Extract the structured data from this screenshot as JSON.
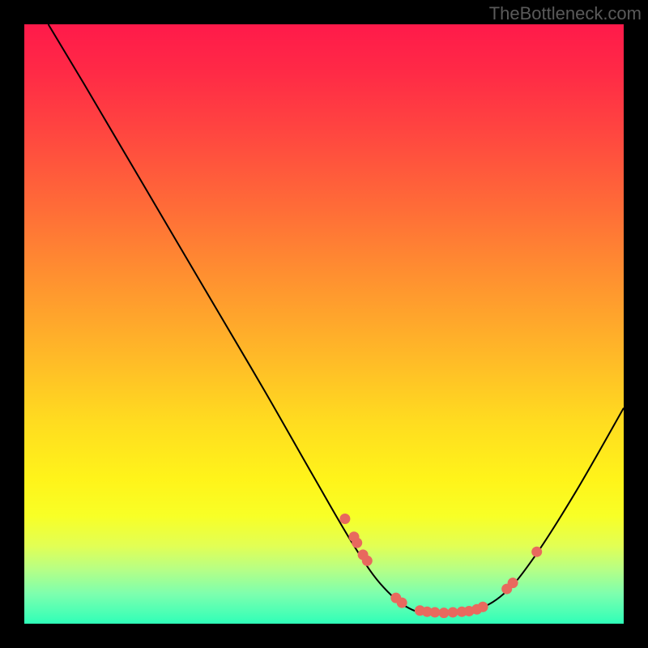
{
  "watermark": "TheBottleneck.com",
  "chart_data": {
    "type": "line",
    "title": "",
    "xlabel": "",
    "ylabel": "",
    "xlim": [
      0,
      100
    ],
    "ylim": [
      0,
      100
    ],
    "curve": [
      {
        "x": 4,
        "y": 100
      },
      {
        "x": 10,
        "y": 90
      },
      {
        "x": 20,
        "y": 73
      },
      {
        "x": 30,
        "y": 56
      },
      {
        "x": 40,
        "y": 39
      },
      {
        "x": 48,
        "y": 25
      },
      {
        "x": 55,
        "y": 13
      },
      {
        "x": 60,
        "y": 6
      },
      {
        "x": 65,
        "y": 2.2
      },
      {
        "x": 70,
        "y": 1.8
      },
      {
        "x": 75,
        "y": 2.2
      },
      {
        "x": 80,
        "y": 5
      },
      {
        "x": 85,
        "y": 11
      },
      {
        "x": 92,
        "y": 22
      },
      {
        "x": 100,
        "y": 36
      }
    ],
    "markers": [
      {
        "x": 53.5,
        "y": 17.5
      },
      {
        "x": 55,
        "y": 14.5
      },
      {
        "x": 55.5,
        "y": 13.5
      },
      {
        "x": 56.5,
        "y": 11.5
      },
      {
        "x": 57.2,
        "y": 10.5
      },
      {
        "x": 62,
        "y": 4.3
      },
      {
        "x": 63,
        "y": 3.5
      },
      {
        "x": 66,
        "y": 2.2
      },
      {
        "x": 67.2,
        "y": 2.0
      },
      {
        "x": 68.5,
        "y": 1.9
      },
      {
        "x": 70,
        "y": 1.8
      },
      {
        "x": 71.5,
        "y": 1.9
      },
      {
        "x": 73,
        "y": 2.0
      },
      {
        "x": 74.2,
        "y": 2.1
      },
      {
        "x": 75.5,
        "y": 2.4
      },
      {
        "x": 76.5,
        "y": 2.8
      },
      {
        "x": 80.5,
        "y": 5.8
      },
      {
        "x": 81.5,
        "y": 6.8
      },
      {
        "x": 85.5,
        "y": 12
      }
    ]
  }
}
